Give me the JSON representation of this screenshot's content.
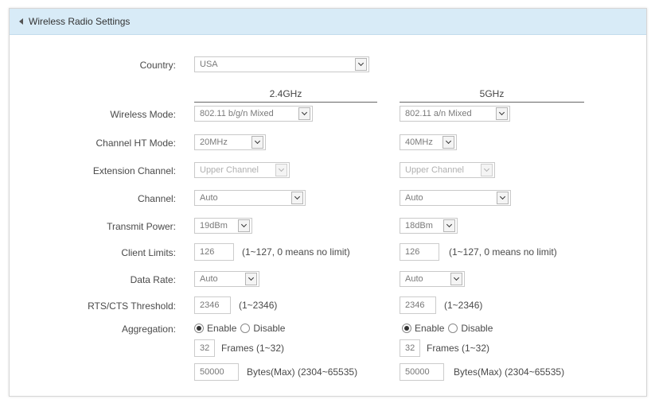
{
  "panel": {
    "title": "Wireless Radio Settings"
  },
  "country": {
    "label": "Country:",
    "value": "USA"
  },
  "columns": {
    "band_24": "2.4GHz",
    "band_5": "5GHz"
  },
  "labels": {
    "wireless_mode": "Wireless Mode:",
    "channel_ht_mode": "Channel HT Mode:",
    "extension_channel": "Extension Channel:",
    "channel": "Channel:",
    "transmit_power": "Transmit Power:",
    "client_limits": "Client Limits:",
    "data_rate": "Data Rate:",
    "rts_cts": "RTS/CTS Threshold:",
    "aggregation": "Aggregation:"
  },
  "band_24": {
    "wireless_mode": "802.11 b/g/n Mixed",
    "channel_ht_mode": "20MHz",
    "extension_channel": "Upper Channel",
    "channel": "Auto",
    "transmit_power": "19dBm",
    "client_limits": "126",
    "client_limits_hint": "(1~127, 0 means no limit)",
    "data_rate": "Auto",
    "rts_cts": "2346",
    "rts_cts_hint": "(1~2346)",
    "aggregation_enable": "Enable",
    "aggregation_disable": "Disable",
    "frames": "32",
    "frames_hint": "Frames (1~32)",
    "bytes": "50000",
    "bytes_hint": "Bytes(Max) (2304~65535)"
  },
  "band_5": {
    "wireless_mode": "802.11 a/n Mixed",
    "channel_ht_mode": "40MHz",
    "extension_channel": "Upper Channel",
    "channel": "Auto",
    "transmit_power": "18dBm",
    "client_limits": "126",
    "client_limits_hint": "(1~127, 0 means no limit)",
    "data_rate": "Auto",
    "rts_cts": "2346",
    "rts_cts_hint": "(1~2346)",
    "aggregation_enable": "Enable",
    "aggregation_disable": "Disable",
    "frames": "32",
    "frames_hint": "Frames (1~32)",
    "bytes": "50000",
    "bytes_hint": "Bytes(Max) (2304~65535)"
  }
}
